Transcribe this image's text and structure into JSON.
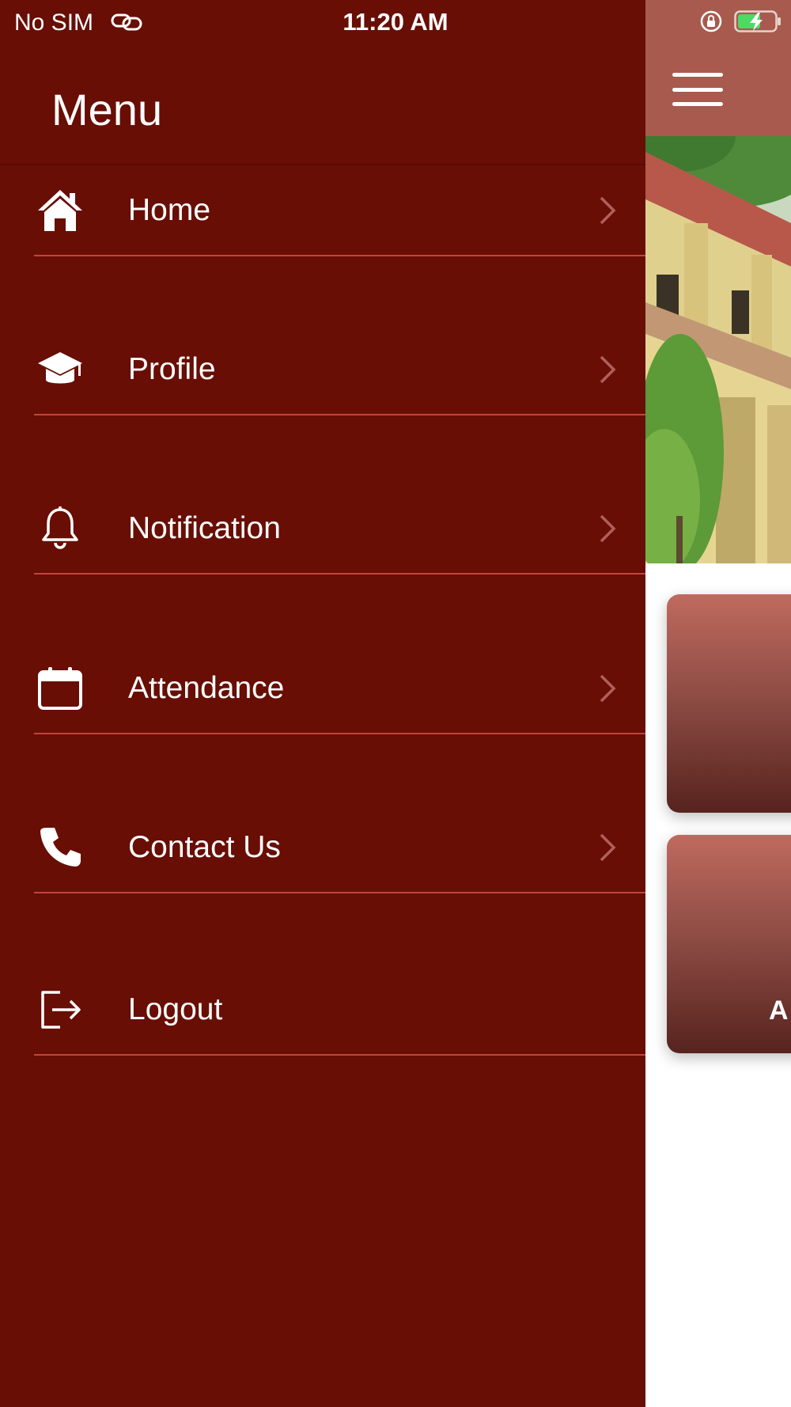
{
  "status_bar": {
    "carrier": "No SIM",
    "time": "11:20 AM",
    "icons": [
      "link-icon",
      "orientation-lock-icon",
      "battery-charging-icon"
    ]
  },
  "app": {
    "header_color": "#a85a4e",
    "menu_button_icon": "hamburger-icon",
    "card_partial_label": "A"
  },
  "drawer": {
    "title": "Menu",
    "background": "#680e05",
    "divider_color": "#c2453a",
    "items": [
      {
        "label": "Home",
        "icon": "home-icon"
      },
      {
        "label": "Profile",
        "icon": "graduation-cap-icon"
      },
      {
        "label": "Notification",
        "icon": "bell-icon"
      },
      {
        "label": "Attendance",
        "icon": "calendar-icon"
      },
      {
        "label": "Contact Us",
        "icon": "phone-icon"
      },
      {
        "label": "Logout",
        "icon": "logout-icon"
      }
    ]
  }
}
